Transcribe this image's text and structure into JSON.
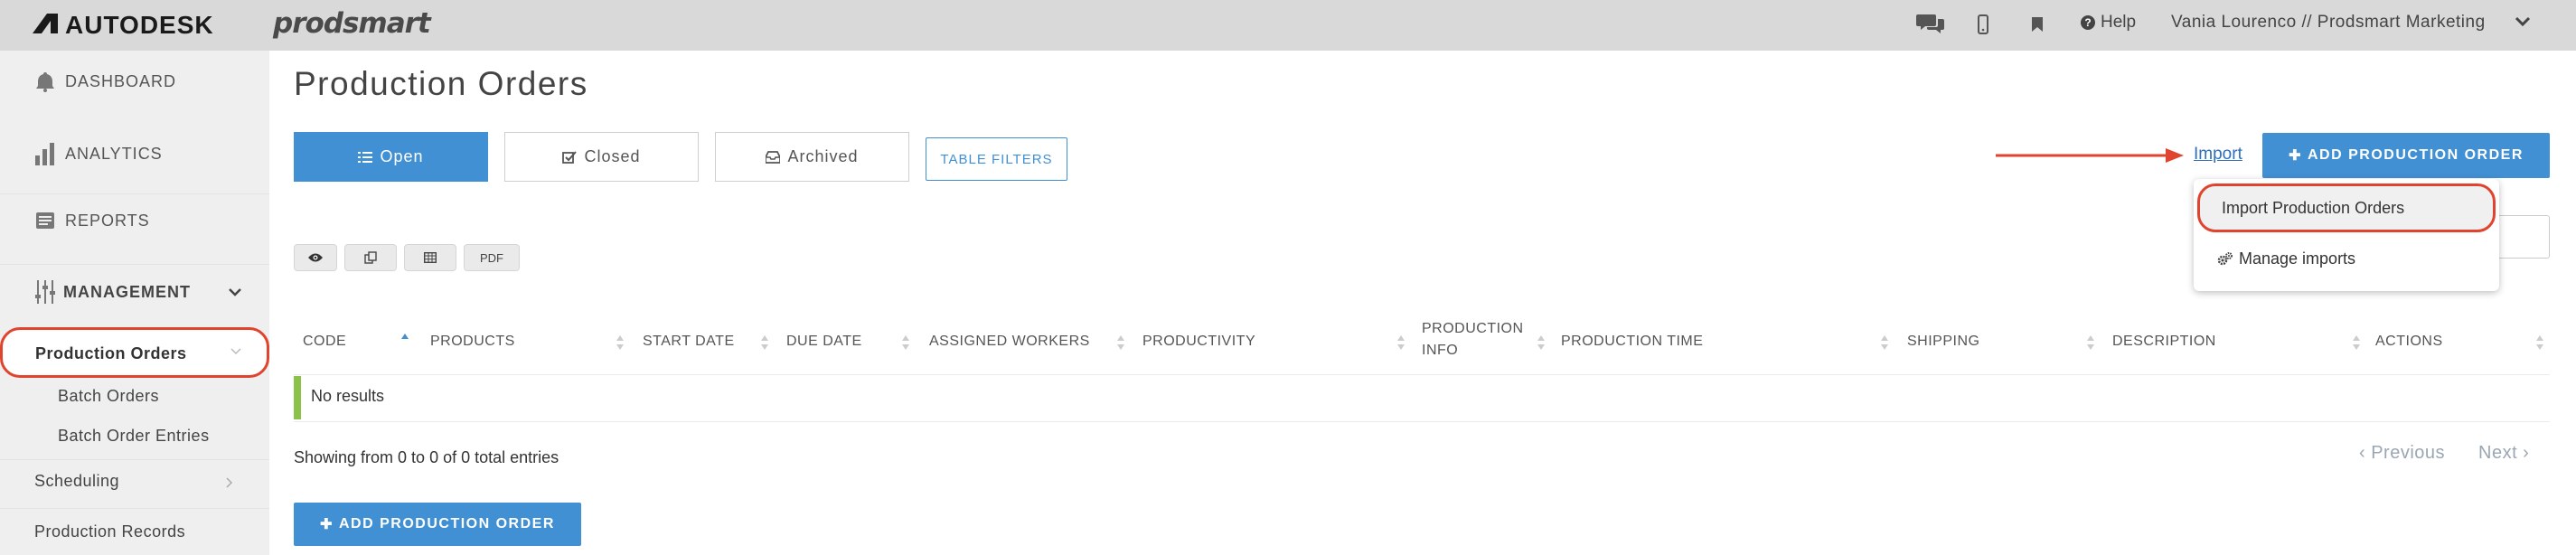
{
  "topbar": {
    "logo": "AUTODESK",
    "brand": "prodsmart",
    "help": "Help",
    "user": "Vania Lourenco // Prodsmart Marketing",
    "icons": [
      "chat-icon",
      "mobile-icon",
      "bookmark-icon"
    ]
  },
  "sidebar": {
    "dashboard": "DASHBOARD",
    "analytics": "ANALYTICS",
    "reports": "REPORTS",
    "management": "MANAGEMENT",
    "production_orders": "Production Orders",
    "batch_orders": "Batch Orders",
    "batch_order_entries": "Batch Order Entries",
    "scheduling": "Scheduling",
    "production_records": "Production Records"
  },
  "main": {
    "title": "Production Orders",
    "tabs": {
      "open": "Open",
      "closed": "Closed",
      "archived": "Archived"
    },
    "table_filters": "TABLE FILTERS",
    "import": "Import",
    "add_button": "ADD PRODUCTION ORDER",
    "dropdown": {
      "import_production_orders": "Import Production Orders",
      "manage_imports": "Manage imports"
    },
    "tools": {
      "pdf": "PDF"
    },
    "columns": {
      "code": "CODE",
      "products": "PRODUCTS",
      "start_date": "START DATE",
      "due_date": "DUE DATE",
      "assigned_workers": "ASSIGNED WORKERS",
      "productivity": "PRODUCTIVITY",
      "production_info_1": "PRODUCTION",
      "production_info_2": "INFO",
      "production_time": "PRODUCTION TIME",
      "shipping": "SHIPPING",
      "description": "DESCRIPTION",
      "actions": "ACTIONS"
    },
    "no_results": "No results",
    "showing": "Showing from 0 to 0 of 0 total entries",
    "previous": "Previous",
    "next": "Next"
  },
  "colors": {
    "primary": "#4190d4",
    "highlight": "#e0442e",
    "success": "#8bc34a"
  }
}
